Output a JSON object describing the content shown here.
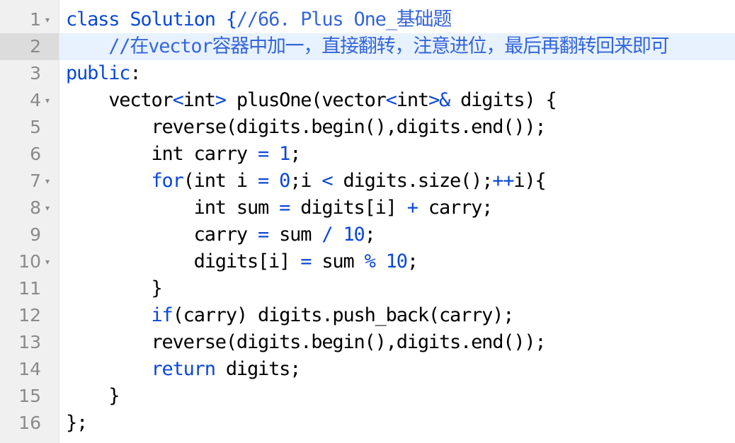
{
  "editor": {
    "colors": {
      "keyword": "#0b48d8",
      "comment": "#3566d8",
      "text": "#000000",
      "gutter_bg": "#f0f0f0",
      "active_line_bg": "#e8f2fe",
      "line_number": "#8a8a8a"
    },
    "fold_icon": "▾",
    "lines": [
      {
        "n": "1",
        "fold": true,
        "active": false,
        "tokens": [
          {
            "t": "kw",
            "v": "class"
          },
          {
            "t": "tx",
            "v": " "
          },
          {
            "t": "kw",
            "v": "Solution"
          },
          {
            "t": "tx",
            "v": " "
          },
          {
            "t": "kw",
            "v": "{"
          },
          {
            "t": "cm",
            "v": "//66. Plus One_基础题"
          }
        ]
      },
      {
        "n": "2",
        "fold": false,
        "active": true,
        "tokens": [
          {
            "t": "tx",
            "v": "    "
          },
          {
            "t": "cm",
            "v": "//在vector容器中加一，直接翻转，注意进位，最后再翻转回来即可"
          }
        ]
      },
      {
        "n": "3",
        "fold": false,
        "active": false,
        "tokens": [
          {
            "t": "kw",
            "v": "public"
          },
          {
            "t": "tx",
            "v": ":"
          }
        ]
      },
      {
        "n": "4",
        "fold": true,
        "active": false,
        "tokens": [
          {
            "t": "tx",
            "v": "    vector"
          },
          {
            "t": "op",
            "v": "<"
          },
          {
            "t": "tx",
            "v": "int"
          },
          {
            "t": "op",
            "v": ">"
          },
          {
            "t": "tx",
            "v": " plusOne(vector"
          },
          {
            "t": "op",
            "v": "<"
          },
          {
            "t": "tx",
            "v": "int"
          },
          {
            "t": "op",
            "v": ">&"
          },
          {
            "t": "tx",
            "v": " digits) {"
          }
        ]
      },
      {
        "n": "5",
        "fold": false,
        "active": false,
        "tokens": [
          {
            "t": "tx",
            "v": "        reverse(digits.begin(),digits.end());"
          }
        ]
      },
      {
        "n": "6",
        "fold": false,
        "active": false,
        "tokens": [
          {
            "t": "tx",
            "v": "        int carry "
          },
          {
            "t": "op",
            "v": "="
          },
          {
            "t": "tx",
            "v": " "
          },
          {
            "t": "num",
            "v": "1"
          },
          {
            "t": "tx",
            "v": ";"
          }
        ]
      },
      {
        "n": "7",
        "fold": true,
        "active": false,
        "tokens": [
          {
            "t": "tx",
            "v": "        "
          },
          {
            "t": "kw",
            "v": "for"
          },
          {
            "t": "tx",
            "v": "(int i "
          },
          {
            "t": "op",
            "v": "="
          },
          {
            "t": "tx",
            "v": " "
          },
          {
            "t": "num",
            "v": "0"
          },
          {
            "t": "tx",
            "v": ";i "
          },
          {
            "t": "op",
            "v": "<"
          },
          {
            "t": "tx",
            "v": " digits.size();"
          },
          {
            "t": "op",
            "v": "++"
          },
          {
            "t": "tx",
            "v": "i){"
          }
        ]
      },
      {
        "n": "8",
        "fold": true,
        "active": false,
        "tokens": [
          {
            "t": "tx",
            "v": "            int sum "
          },
          {
            "t": "op",
            "v": "="
          },
          {
            "t": "tx",
            "v": " digits[i] "
          },
          {
            "t": "op",
            "v": "+"
          },
          {
            "t": "tx",
            "v": " carry;"
          }
        ]
      },
      {
        "n": "9",
        "fold": false,
        "active": false,
        "tokens": [
          {
            "t": "tx",
            "v": "            carry "
          },
          {
            "t": "op",
            "v": "="
          },
          {
            "t": "tx",
            "v": " sum "
          },
          {
            "t": "op",
            "v": "/"
          },
          {
            "t": "tx",
            "v": " "
          },
          {
            "t": "num",
            "v": "10"
          },
          {
            "t": "tx",
            "v": ";"
          }
        ]
      },
      {
        "n": "10",
        "fold": true,
        "active": false,
        "tokens": [
          {
            "t": "tx",
            "v": "            digits[i] "
          },
          {
            "t": "op",
            "v": "="
          },
          {
            "t": "tx",
            "v": " sum "
          },
          {
            "t": "op",
            "v": "%"
          },
          {
            "t": "tx",
            "v": " "
          },
          {
            "t": "num",
            "v": "10"
          },
          {
            "t": "tx",
            "v": ";"
          }
        ]
      },
      {
        "n": "11",
        "fold": false,
        "active": false,
        "tokens": [
          {
            "t": "tx",
            "v": "        }"
          }
        ]
      },
      {
        "n": "12",
        "fold": false,
        "active": false,
        "tokens": [
          {
            "t": "tx",
            "v": "        "
          },
          {
            "t": "kw",
            "v": "if"
          },
          {
            "t": "tx",
            "v": "(carry) digits.push_back(carry);"
          }
        ]
      },
      {
        "n": "13",
        "fold": false,
        "active": false,
        "tokens": [
          {
            "t": "tx",
            "v": "        reverse(digits.begin(),digits.end());"
          }
        ]
      },
      {
        "n": "14",
        "fold": false,
        "active": false,
        "tokens": [
          {
            "t": "tx",
            "v": "        "
          },
          {
            "t": "kw",
            "v": "return"
          },
          {
            "t": "tx",
            "v": " digits;"
          }
        ]
      },
      {
        "n": "15",
        "fold": false,
        "active": false,
        "tokens": [
          {
            "t": "tx",
            "v": "    }"
          }
        ]
      },
      {
        "n": "16",
        "fold": false,
        "active": false,
        "tokens": [
          {
            "t": "tx",
            "v": "};"
          }
        ]
      }
    ]
  }
}
